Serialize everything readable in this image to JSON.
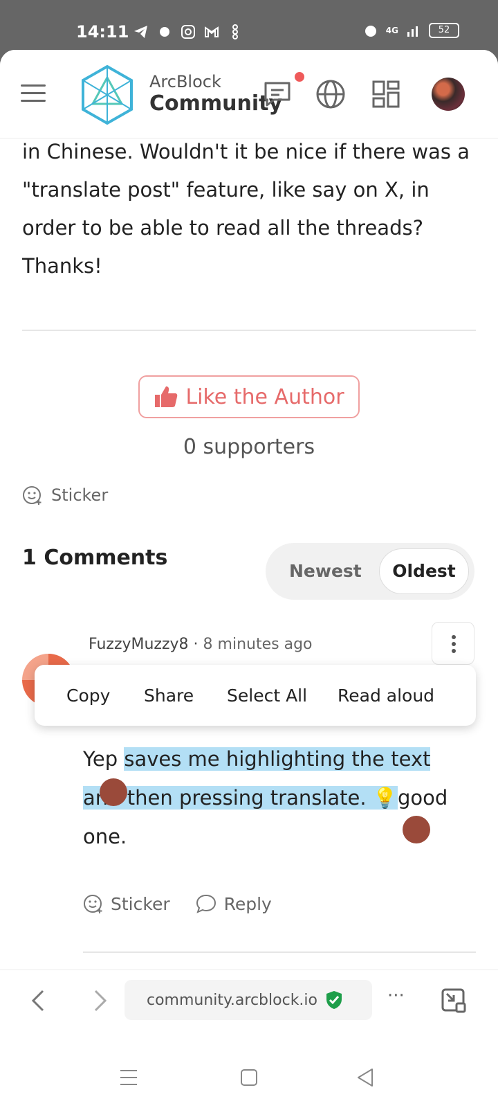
{
  "status_bar": {
    "time": "14:11",
    "network": "4G",
    "battery": "52"
  },
  "header": {
    "brand_top": "ArcBlock",
    "brand_bottom": "Community"
  },
  "post": {
    "text": "in Chinese. Wouldn't it be nice if there was a \"translate post\" feature, like say on X, in order to be able to read all the threads? Thanks!"
  },
  "like": {
    "label": "Like the Author",
    "supporters": "0 supporters"
  },
  "sticker_label": "Sticker",
  "comments": {
    "title": "1 Comments",
    "sort_newest": "Newest",
    "sort_oldest": "Oldest",
    "selected_sort": "Oldest",
    "items": [
      {
        "author": "FuzzyMuzzy8",
        "time": "8 minutes ago",
        "text_pre": "Yep ",
        "text_highlight": "saves me highlighting the text and then pressing translate. 💡",
        "text_post": "good one.",
        "sticker": "Sticker",
        "reply": "Reply"
      }
    ]
  },
  "context_menu": {
    "copy": "Copy",
    "share": "Share",
    "select_all": "Select All",
    "read_aloud": "Read aloud"
  },
  "browser": {
    "url": "community.arcblock.io",
    "more": "···"
  },
  "colors": {
    "accent_red": "#e66a6a",
    "highlight": "#b3dff5",
    "secure_green": "#1e9e4a"
  }
}
